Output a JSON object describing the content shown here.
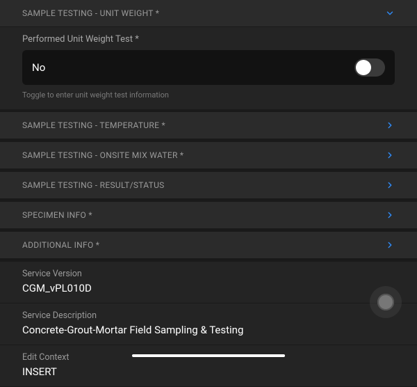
{
  "colors": {
    "accent": "#2f8af5"
  },
  "sections": {
    "unitWeight": {
      "title": "SAMPLE TESTING - UNIT WEIGHT *",
      "field_label": "Performed Unit Weight Test *",
      "value": "No",
      "helper": "Toggle to enter unit weight test information",
      "toggle_on": false
    },
    "temperature": {
      "title": "SAMPLE TESTING - TEMPERATURE *"
    },
    "mixWater": {
      "title": "SAMPLE TESTING - ONSITE MIX WATER *"
    },
    "result": {
      "title": "SAMPLE TESTING - RESULT/STATUS"
    },
    "specimen": {
      "title": "SPECIMEN INFO *"
    },
    "additional": {
      "title": "ADDITIONAL INFO *"
    }
  },
  "info": {
    "serviceVersion": {
      "label": "Service Version",
      "value": "CGM_vPL010D"
    },
    "serviceDescription": {
      "label": "Service Description",
      "value": "Concrete-Grout-Mortar Field Sampling & Testing"
    },
    "editContext": {
      "label": "Edit Context",
      "value": "INSERT"
    }
  }
}
